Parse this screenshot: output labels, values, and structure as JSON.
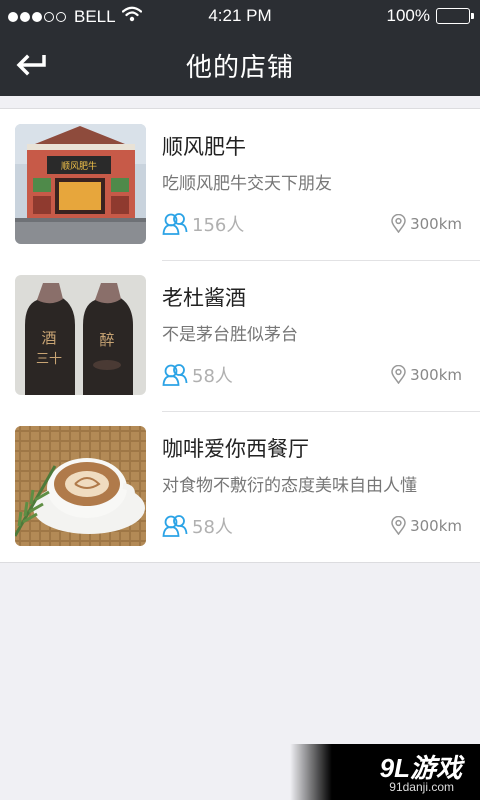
{
  "status": {
    "carrier": "BELL",
    "time": "4:21 PM",
    "battery": "100%",
    "signal_bars_filled": 3,
    "signal_bars_total": 5
  },
  "nav": {
    "title": "他的店铺",
    "back_icon": "back-arrow-icon"
  },
  "shops": [
    {
      "name": "顺风肥牛",
      "desc": "吃顺风肥牛交天下朋友",
      "followers": "156人",
      "distance": "300km"
    },
    {
      "name": "老杜酱酒",
      "desc": "不是茅台胜似茅台",
      "followers": "58人",
      "distance": "300km"
    },
    {
      "name": "咖啡爱你西餐厅",
      "desc": "对食物不敷衍的态度美味自由人懂",
      "followers": "58人",
      "distance": "300km"
    }
  ],
  "watermark": {
    "brand": "9L游戏",
    "site": "91danji.com"
  },
  "colors": {
    "nav_bg": "#2b2e33",
    "accent_blue": "#2ba3e6",
    "page_bg": "#f0f0f4"
  }
}
